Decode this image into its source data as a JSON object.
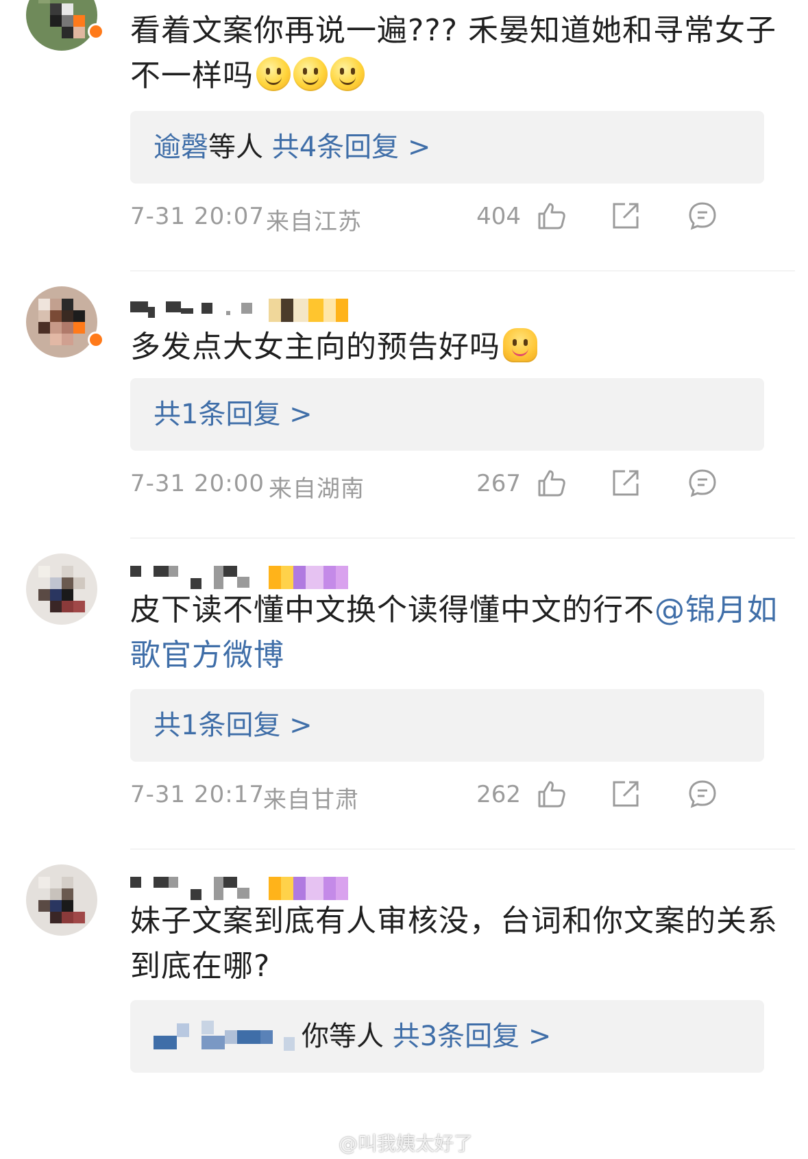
{
  "comments": [
    {
      "text": "看着文案你再说一遍???  禾晏知道她和寻常女子不一样吗",
      "replies_prefix": "逾磬",
      "replies_mid": "等人",
      "replies_link": "共4条回复 >",
      "time": "7-31 20:07",
      "location": "来自江苏",
      "likes": "404"
    },
    {
      "text": "多发点大女主向的预告好吗",
      "replies_link": "共1条回复 >",
      "time": "7-31 20:00",
      "location": "来自湖南",
      "likes": "267"
    },
    {
      "text": "皮下读不懂中文换个读得懂中文的行不",
      "mention": "@锦月如歌官方微博",
      "replies_link": "共1条回复 >",
      "time": "7-31 20:17",
      "location": "来自甘肃",
      "likes": "262"
    },
    {
      "text": "妹子文案到底有人审核没，台词和你文案的关系到底在哪?",
      "replies_mid": "你等人",
      "replies_link": "共3条回复 >"
    }
  ],
  "icons": {
    "like": "thumbs-up-icon",
    "share": "share-icon",
    "comment": "comment-icon",
    "smile": "smile-emoji",
    "hug": "hug-emoji"
  },
  "colors": {
    "link": "#3f6ea8",
    "meta": "#9b9b9b",
    "reply_bg": "#f2f2f2",
    "badge_orange": "#ff7a1a"
  },
  "watermark": "@叫我姨太好了"
}
